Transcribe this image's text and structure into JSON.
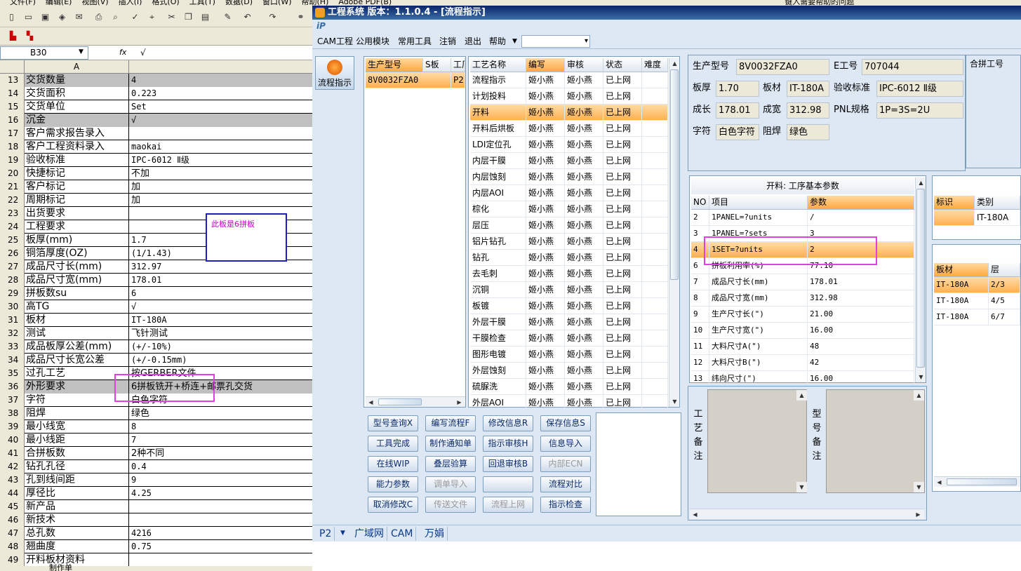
{
  "excel": {
    "menu": [
      "文件(F)",
      "编辑(E)",
      "视图(V)",
      "插入(I)",
      "格式(O)",
      "工具(T)",
      "数据(D)",
      "窗口(W)",
      "帮助(H)",
      "Adobe PDF(B)"
    ],
    "help_placeholder": "键入需要帮助的问题",
    "name_box": "B30",
    "fx_label": "fx",
    "formula_value": "√",
    "column_a_header": "A",
    "rows": [
      {
        "num": "13",
        "a": "交货数量",
        "b": "4",
        "hl": true
      },
      {
        "num": "14",
        "a": "交货面积",
        "b": "0.223"
      },
      {
        "num": "15",
        "a": "交货单位",
        "b": "Set"
      },
      {
        "num": "16",
        "a": "沉金",
        "b": "√",
        "hl": true
      },
      {
        "num": "17",
        "a": "客户需求报告录入",
        "b": ""
      },
      {
        "num": "18",
        "a": "客户工程资料录入",
        "b": "maokai"
      },
      {
        "num": "19",
        "a": "验收标准",
        "b": "IPC-6012 Ⅱ级"
      },
      {
        "num": "20",
        "a": "快捷标记",
        "b": "不加"
      },
      {
        "num": "21",
        "a": "客户标记",
        "b": "加"
      },
      {
        "num": "22",
        "a": "周期标记",
        "b": "加"
      },
      {
        "num": "23",
        "a": "出货要求",
        "b": ""
      },
      {
        "num": "24",
        "a": "工程要求",
        "b": ""
      },
      {
        "num": "25",
        "a": "板厚(mm)",
        "b": "1.7"
      },
      {
        "num": "26",
        "a": "铜箔厚度(OZ)",
        "b": "(1/1.43)"
      },
      {
        "num": "27",
        "a": "成品尺寸长(mm)",
        "b": "312.97"
      },
      {
        "num": "28",
        "a": "成品尺寸宽(mm)",
        "b": "178.01"
      },
      {
        "num": "29",
        "a": "拼板数su",
        "b": "6"
      },
      {
        "num": "30",
        "a": "高TG",
        "b": "√"
      },
      {
        "num": "31",
        "a": "板材",
        "b": "IT-180A"
      },
      {
        "num": "32",
        "a": "测试",
        "b": "飞针测试"
      },
      {
        "num": "33",
        "a": "成品板厚公差(mm)",
        "b": "(+/-10%)"
      },
      {
        "num": "34",
        "a": "成品尺寸长宽公差",
        "b": "(+/-0.15mm)"
      },
      {
        "num": "35",
        "a": "过孔工艺",
        "b": "按GERBER文件"
      },
      {
        "num": "36",
        "a": "外形要求",
        "b": "6拼板铣开+桥连+邮票孔交货",
        "hl": true
      },
      {
        "num": "37",
        "a": "字符",
        "b": "白色字符"
      },
      {
        "num": "38",
        "a": "阻焊",
        "b": "绿色"
      },
      {
        "num": "39",
        "a": "最小线宽",
        "b": "8"
      },
      {
        "num": "40",
        "a": "最小线距",
        "b": "7"
      },
      {
        "num": "41",
        "a": "合拼板数",
        "b": "2种不同"
      },
      {
        "num": "42",
        "a": "钻孔孔径",
        "b": "0.4"
      },
      {
        "num": "43",
        "a": "孔到线间距",
        "b": "9"
      },
      {
        "num": "44",
        "a": "厚径比",
        "b": "4.25"
      },
      {
        "num": "45",
        "a": "新产品",
        "b": ""
      },
      {
        "num": "46",
        "a": "新技术",
        "b": ""
      },
      {
        "num": "47",
        "a": "总孔数",
        "b": "4216"
      },
      {
        "num": "48",
        "a": "翘曲度",
        "b": "0.75"
      },
      {
        "num": "49",
        "a": "开料板材资料",
        "b": ""
      }
    ],
    "note_text": "此板是6拼板",
    "sheet_tab": "制作单"
  },
  "cam": {
    "title": "工程系统    版本：1.1.0.4 - [流程指示]",
    "menu": [
      "CAM工程",
      "公用模块",
      "常用工具",
      "注销",
      "退出",
      "帮助"
    ],
    "nav_button": "流程指示",
    "model_grid": {
      "headers": [
        "生产型号",
        "S板",
        "工厂"
      ],
      "rows": [
        [
          "8V0032FZA0",
          "P2"
        ]
      ]
    },
    "process_grid": {
      "headers": [
        "工艺名称",
        "编写",
        "审核",
        "状态",
        "难度"
      ],
      "rows": [
        [
          "流程指示",
          "姬小燕",
          "姬小燕",
          "已上网"
        ],
        [
          "计划投料",
          "姬小燕",
          "姬小燕",
          "已上网"
        ],
        [
          "开料",
          "姬小燕",
          "姬小燕",
          "已上网"
        ],
        [
          "开料后烘板",
          "姬小燕",
          "姬小燕",
          "已上网"
        ],
        [
          "LDI定位孔",
          "姬小燕",
          "姬小燕",
          "已上网"
        ],
        [
          "内层干膜",
          "姬小燕",
          "姬小燕",
          "已上网"
        ],
        [
          "内层蚀刻",
          "姬小燕",
          "姬小燕",
          "已上网"
        ],
        [
          "内层AOI",
          "姬小燕",
          "姬小燕",
          "已上网"
        ],
        [
          "棕化",
          "姬小燕",
          "姬小燕",
          "已上网"
        ],
        [
          "层压",
          "姬小燕",
          "姬小燕",
          "已上网"
        ],
        [
          "铝片钻孔",
          "姬小燕",
          "姬小燕",
          "已上网"
        ],
        [
          "钻孔",
          "姬小燕",
          "姬小燕",
          "已上网"
        ],
        [
          "去毛刺",
          "姬小燕",
          "姬小燕",
          "已上网"
        ],
        [
          "沉铜",
          "姬小燕",
          "姬小燕",
          "已上网"
        ],
        [
          "板镀",
          "姬小燕",
          "姬小燕",
          "已上网"
        ],
        [
          "外层干膜",
          "姬小燕",
          "姬小燕",
          "已上网"
        ],
        [
          "干膜检查",
          "姬小燕",
          "姬小燕",
          "已上网"
        ],
        [
          "图形电镀",
          "姬小燕",
          "姬小燕",
          "已上网"
        ],
        [
          "外层蚀刻",
          "姬小燕",
          "姬小燕",
          "已上网"
        ],
        [
          "硫脲洗",
          "姬小燕",
          "姬小燕",
          "已上网"
        ],
        [
          "外层AOI",
          "姬小燕",
          "姬小燕",
          "已上网"
        ]
      ],
      "selected_index": 2
    },
    "buttons": [
      [
        "型号查询X",
        "编写流程F",
        "修改信息R",
        "保存信息S"
      ],
      [
        "工具完成",
        "制作通知单",
        "指示审核H",
        "信息导入"
      ],
      [
        "在线WIP",
        "叠层验算",
        "回退审核B",
        "内部ECN"
      ],
      [
        "能力参数",
        "调单导入",
        "",
        "流程对比"
      ],
      [
        "取消修改C",
        "传送文件",
        "流程上网",
        "指示检查"
      ]
    ],
    "disabled_buttons": [
      "内部ECN",
      "调单导入",
      "传送文件",
      "流程上网"
    ],
    "info": {
      "model_label": "生产型号",
      "model_value": "8V0032FZA0",
      "e_label": "E工号",
      "e_value": "707044",
      "thick_label": "板厚",
      "thick_value": "1.70",
      "mat_label": "板材",
      "mat_value": "IT-180A",
      "std_label": "验收标准",
      "std_value": "IPC-6012 Ⅱ级",
      "len_label": "成长",
      "len_value": "178.01",
      "wid_label": "成宽",
      "wid_value": "312.98",
      "pnl_label": "PNL规格",
      "pnl_value": "1P=3S=2U",
      "char_label": "字符",
      "char_value": "白色字符",
      "mask_label": "阻焊",
      "mask_value": "绿色",
      "combine_label": "合拼工号"
    },
    "param_grid": {
      "title": "开料: 工序基本参数",
      "headers": [
        "NO",
        "项目",
        "参数"
      ],
      "rows": [
        [
          "2",
          "1PANEL=?units",
          "/"
        ],
        [
          "3",
          "1PANEL=?sets",
          "3"
        ],
        [
          "4",
          "1SET=?units",
          "2"
        ],
        [
          "6",
          "拼板利用率(%)",
          "77.10"
        ],
        [
          "7",
          "成品尺寸长(mm)",
          "178.01"
        ],
        [
          "8",
          "成品尺寸宽(mm)",
          "312.98"
        ],
        [
          "9",
          "生产尺寸长(\")",
          "21.00"
        ],
        [
          "10",
          "生产尺寸宽(\")",
          "16.00"
        ],
        [
          "11",
          "大料尺寸A(\")",
          "48"
        ],
        [
          "12",
          "大料尺寸B(\")",
          "42"
        ],
        [
          "13",
          "纬向尺寸(\")",
          "16.00"
        ]
      ],
      "selected_index": 2
    },
    "mark_grid": {
      "headers": [
        "标识",
        "类别"
      ],
      "rows": [
        [
          "",
          "IT-180A"
        ]
      ]
    },
    "stack_grid": {
      "headers": [
        "板材",
        "层"
      ],
      "rows": [
        [
          "IT-180A",
          "2/3"
        ],
        [
          "IT-180A",
          "4/5"
        ],
        [
          "IT-180A",
          "6/7"
        ]
      ]
    },
    "process_note_label": [
      "工",
      "艺",
      "备",
      "注"
    ],
    "model_note_label": [
      "型",
      "号",
      "备",
      "注"
    ],
    "status": [
      "P2",
      "广域网",
      "CAM",
      "万娟"
    ]
  }
}
